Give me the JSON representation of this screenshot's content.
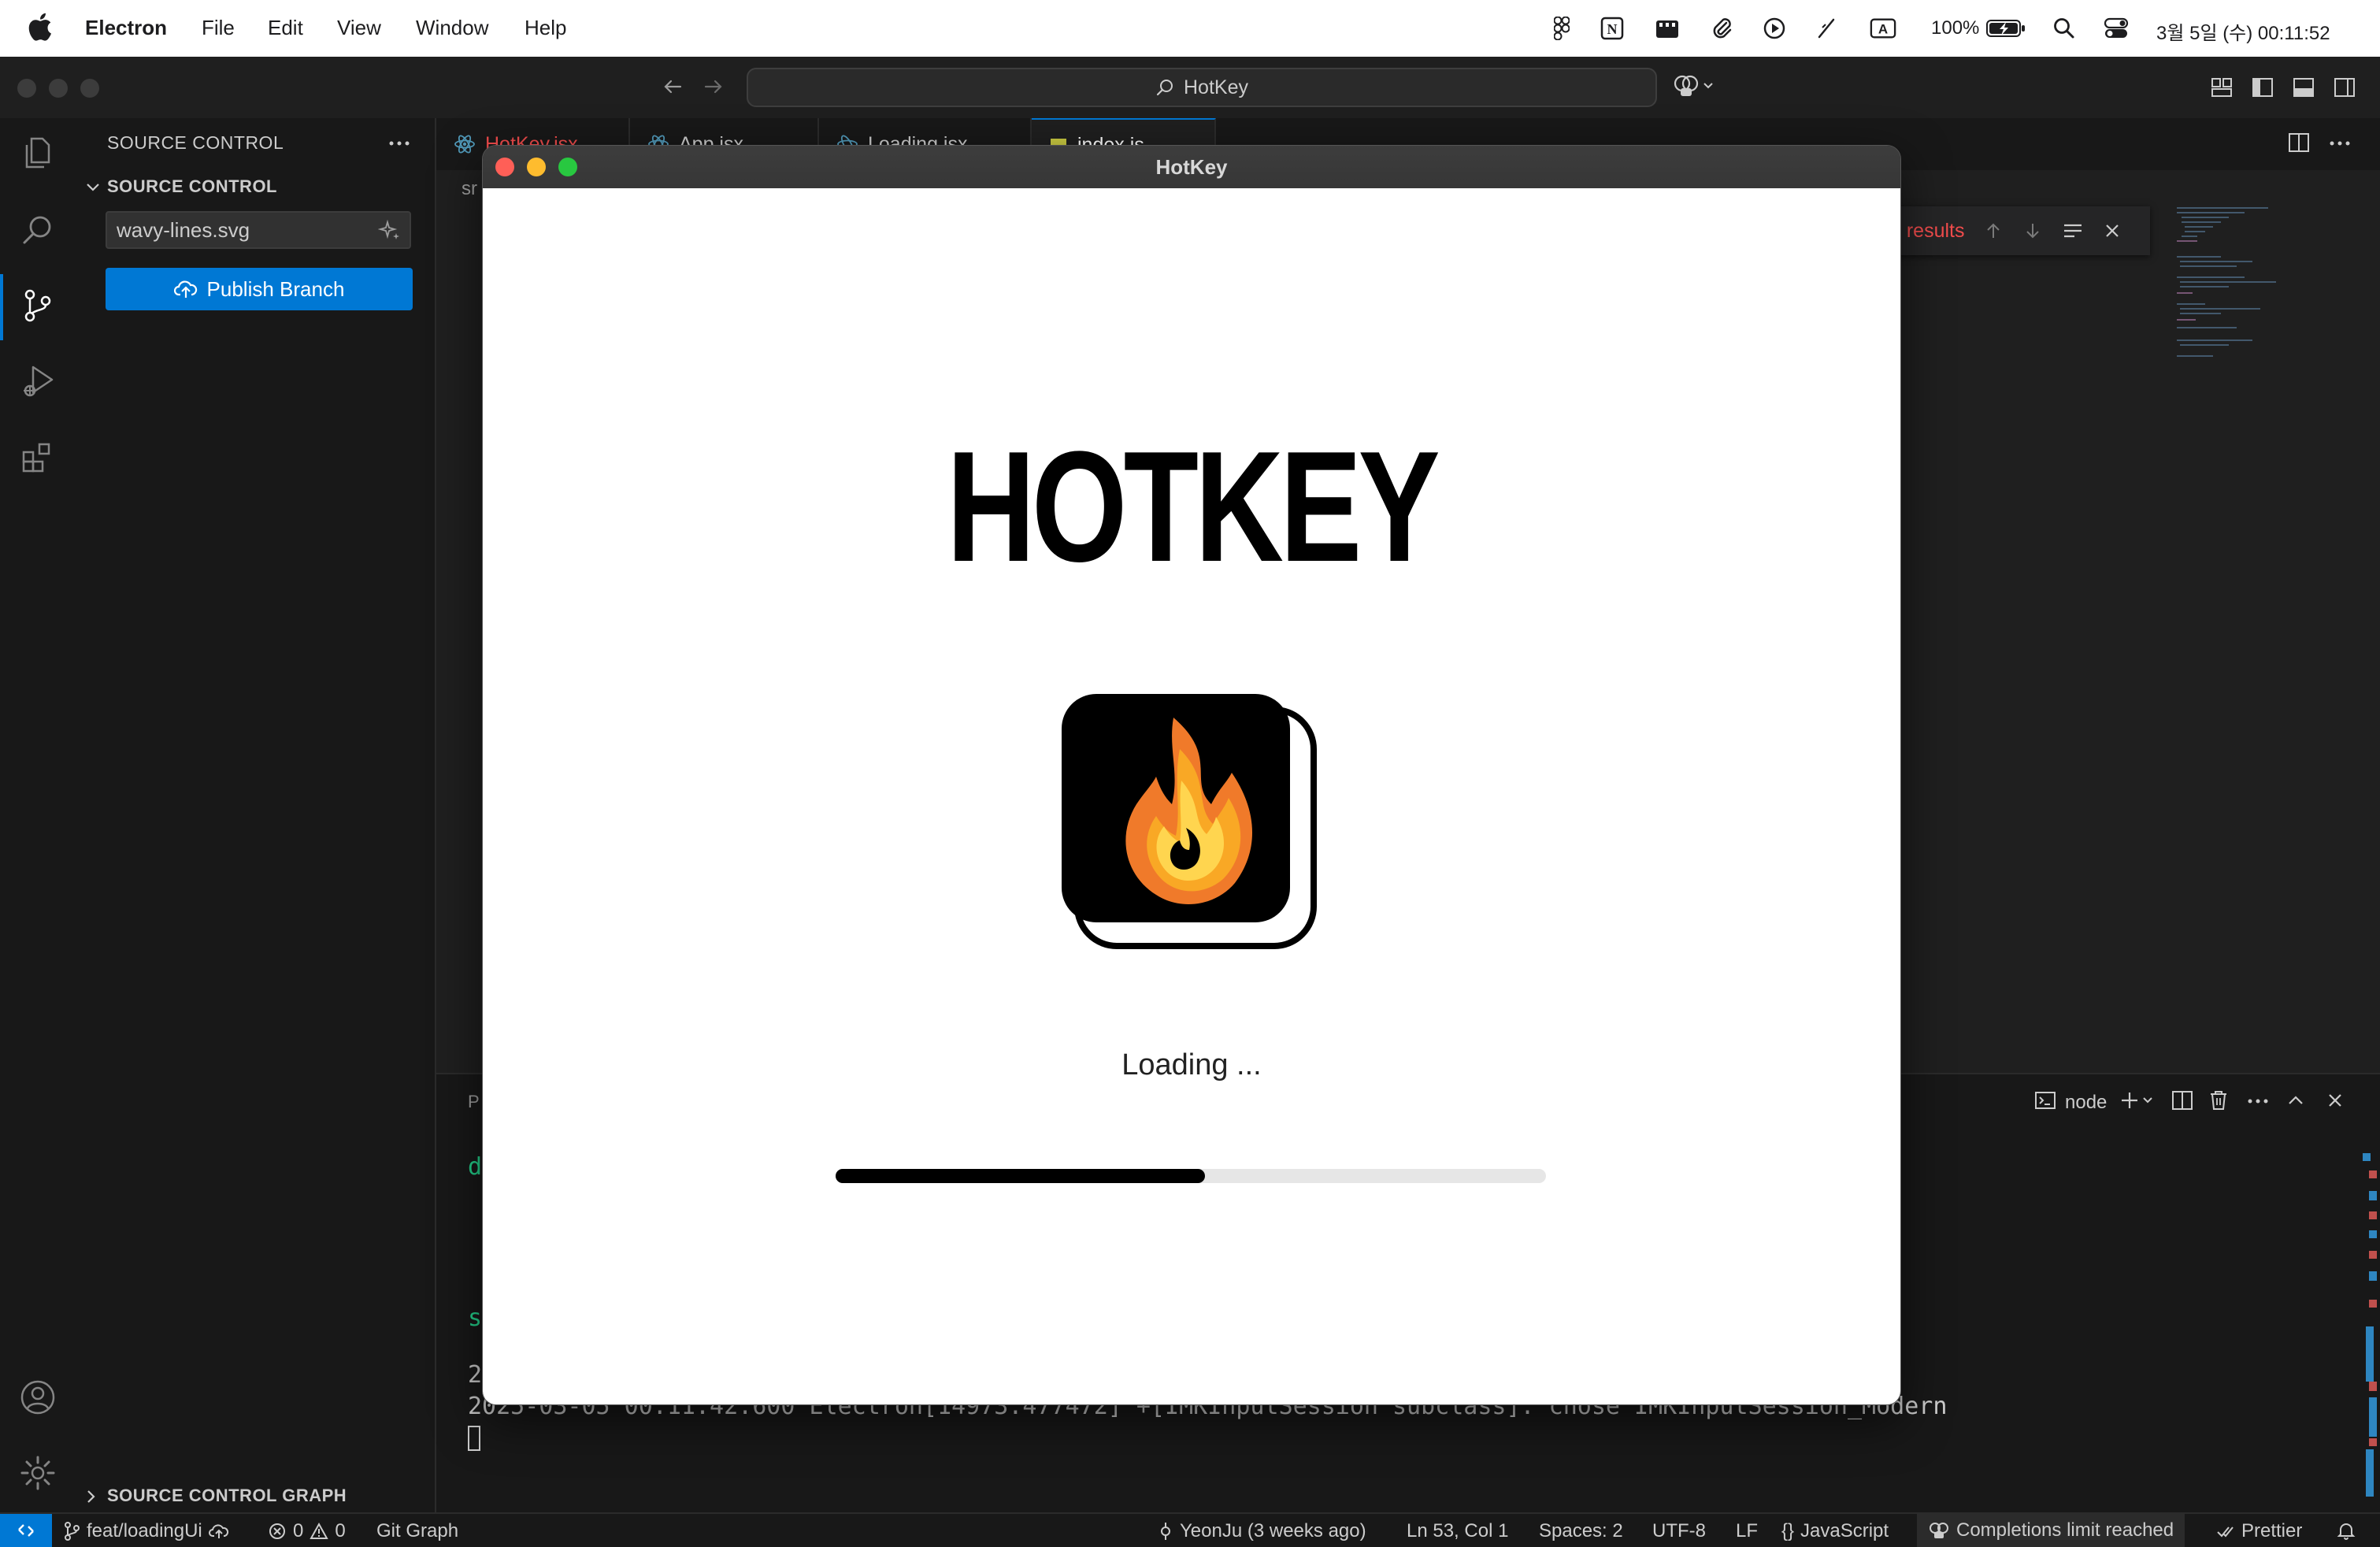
{
  "menubar": {
    "app_name": "Electron",
    "menus": [
      "File",
      "Edit",
      "View",
      "Window",
      "Help"
    ],
    "battery": "100%",
    "clock": "3월 5일 (수) 00:11:52"
  },
  "titlebar": {
    "search_text": "HotKey"
  },
  "sidebar": {
    "header": "SOURCE CONTROL",
    "section_title": "SOURCE CONTROL",
    "commit_message_value": "wavy-lines.svg",
    "publish_button": "Publish Branch",
    "graph_section": "SOURCE CONTROL GRAPH"
  },
  "tabs": [
    {
      "label": "HotKey.jsx"
    },
    {
      "label": "App.jsx"
    },
    {
      "label": "Loading.jsx"
    },
    {
      "label": "index.js"
    }
  ],
  "editor": {
    "breadcrumb_fragment": "sr",
    "find_results": "o results"
  },
  "panel": {
    "title_fragment": "P",
    "terminal_name": "node",
    "lines": [
      "d",
      "s",
      "2",
      "2025-03-05 00:11:42.600 Electron[14973:477472] +[IMKInputSession subclass]: chose IMKInputSession_Modern"
    ]
  },
  "statusbar": {
    "branch": "feat/loadingUi",
    "errors": "0",
    "warnings": "0",
    "git_graph": "Git Graph",
    "blame": "YeonJu (3 weeks ago)",
    "position": "Ln 53, Col 1",
    "spaces": "Spaces: 2",
    "encoding": "UTF-8",
    "eol": "LF",
    "language": "JavaScript",
    "copilot": "Completions limit reached",
    "prettier": "Prettier"
  },
  "hotkey_window": {
    "title": "HotKey",
    "logo_text": "HOTKEY",
    "loading_text": "Loading ...",
    "progress_fraction": 0.52
  },
  "colors": {
    "accent": "#0078d4",
    "progress_fill": "#000000",
    "progress_track": "#e6e6e6",
    "find_results_red": "#f14c4c"
  }
}
